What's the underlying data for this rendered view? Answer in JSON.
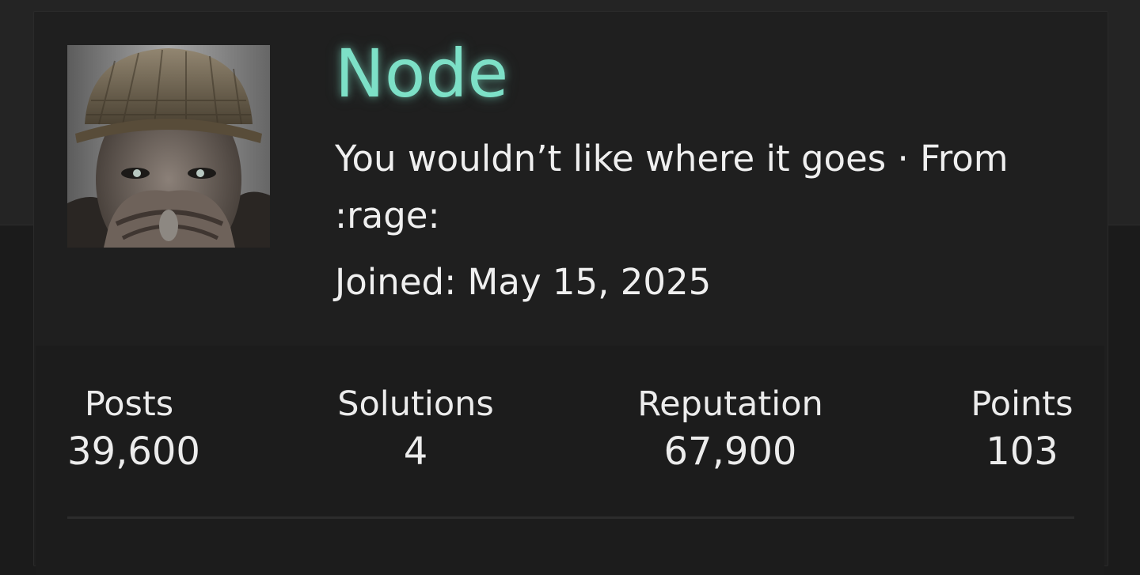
{
  "profile": {
    "name": "Node",
    "tagline": "You wouldn’t like where it goes · From :rage:",
    "joined": "Joined: May 15, 2025",
    "avatar_icon": "soldier-avatar-image"
  },
  "stats": [
    {
      "label": "Posts",
      "value": "39,600"
    },
    {
      "label": "Solutions",
      "value": "4"
    },
    {
      "label": "Reputation",
      "value": "67,900"
    },
    {
      "label": "Points",
      "value": "103"
    }
  ],
  "colors": {
    "name_accent": "#7de0c7",
    "card_background": "#1f1f1f",
    "text": "#efefef"
  }
}
